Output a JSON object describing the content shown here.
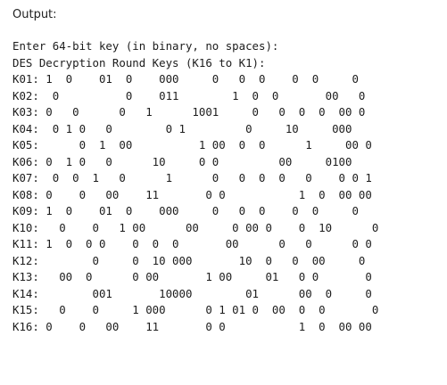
{
  "output_label": "Output:",
  "console": {
    "prompt": "Enter 64-bit key (in binary, no spaces):",
    "heading": "DES Decryption Round Keys (K16 to K1):",
    "rows": [
      "K01: 1  0    01  0    000     0   0  0    0  0     0",
      "K02:  0          0    011        1  0  0       00   0",
      "K03: 0   0      0   1      1001     0   0  0  0  00 0",
      "K04:  0 1 0   0        0 1         0     10     000",
      "K05:      0  1  00          1 00  0  0      1     00 0",
      "K06: 0  1 0   0      10     0 0         00     0100",
      "K07:  0  0  1   0      1      0   0  0  0   0    0 0 1",
      "K08: 0    0   00    11       0 0           1  0  00 00",
      "K09: 1  0    01  0    000     0   0  0    0  0     0",
      "K10:   0    0   1 00      00     0 00 0    0  10      0",
      "K11: 1  0  0 0    0  0  0       00      0   0      0 0",
      "K12:        0     0  10 000       10  0   0  00     0",
      "K13:   00  0      0 00       1 00     01   0 0       0",
      "K14:        001       10000        01      00  0     0",
      "K15:   0    0     1 000      0 1 01 0  00  0  0       0",
      "K16: 0    0   00    11       0 0           1  0  00 00"
    ]
  }
}
